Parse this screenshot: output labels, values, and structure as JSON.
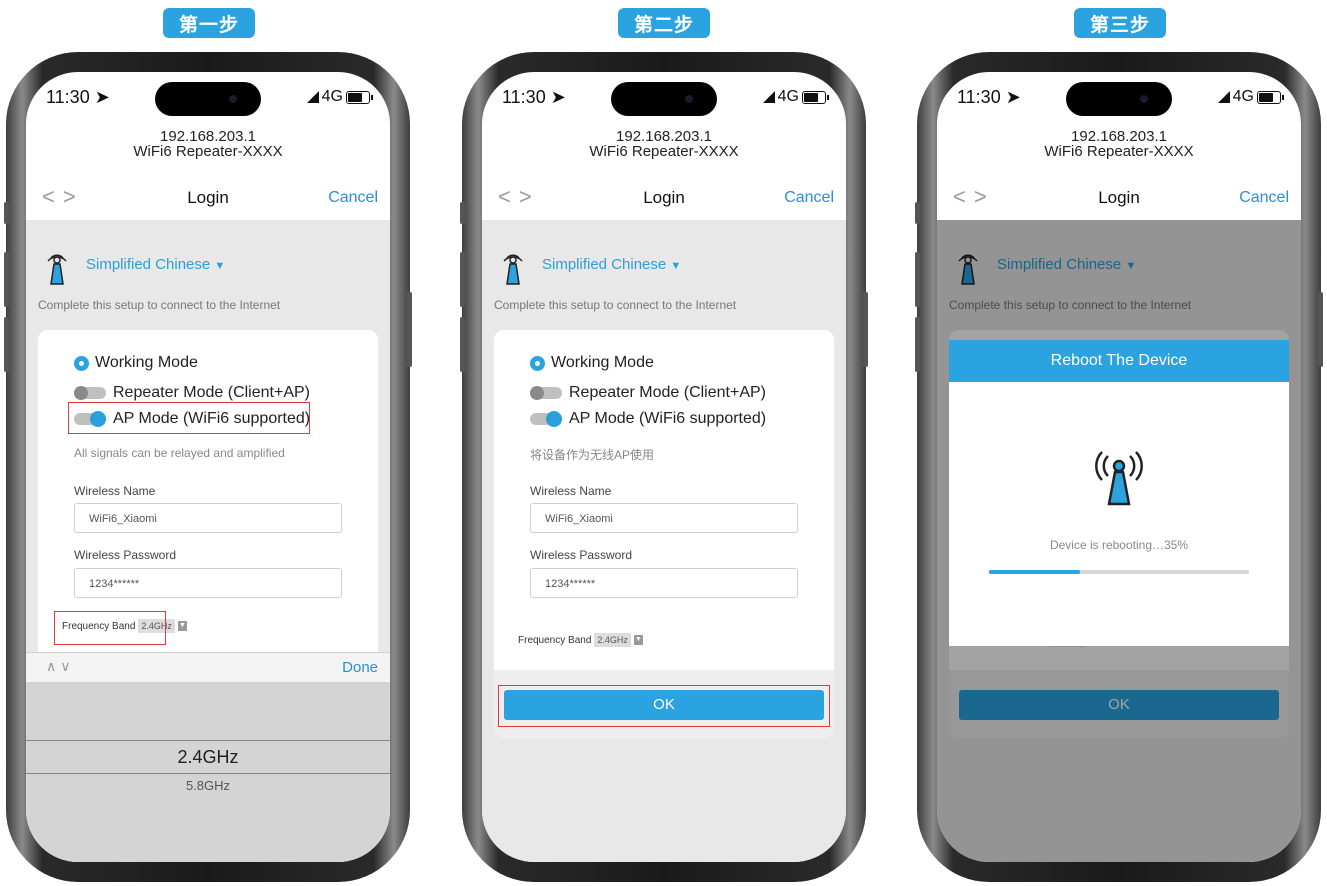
{
  "steps": [
    "第一步",
    "第二步",
    "第三步"
  ],
  "status_time": "11:30",
  "network": "4G",
  "address_line1": "192.168.203.1",
  "address_line2": "WiFi6 Repeater-XXXX",
  "nav": {
    "back": "<",
    "forward": ">",
    "title": "Login",
    "cancel": "Cancel"
  },
  "language": "Simplified Chinese",
  "setup_hint": "Complete this setup to connect to the Internet",
  "working_mode": "Working Mode",
  "repeater_mode": "Repeater Mode (Client+AP)",
  "ap_mode": "AP Mode (WiFi6 supported)",
  "mode_hint_step1": "All signals can be relayed and amplified",
  "mode_hint_step2": "将设备作为无线AP使用",
  "wireless_name_label": "Wireless Name",
  "wireless_name_value": "WiFi6_Xiaomi",
  "wireless_password_label": "Wireless Password",
  "wireless_password_value": "1234******",
  "frequency_band_label": "Frequency Band",
  "frequency_band_value": "2.4GHz",
  "keyboard": {
    "arrows": "^ v",
    "done": "Done"
  },
  "picker_options": [
    "2.4GHz",
    "5.8GHz"
  ],
  "ok_label": "OK",
  "reboot": {
    "title": "Reboot The Device",
    "text": "Device is rebooting…35%",
    "progress": 0.35
  }
}
